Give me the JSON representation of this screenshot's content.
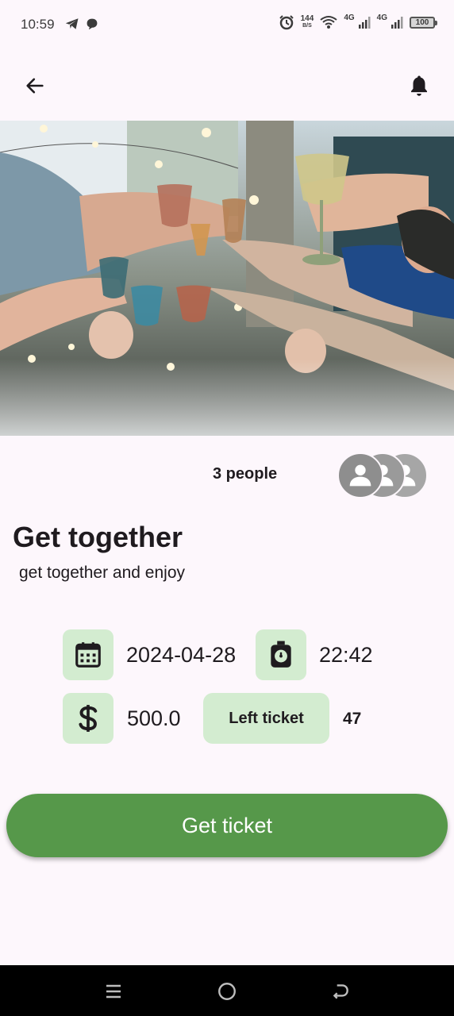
{
  "status_bar": {
    "time": "10:59",
    "net_speed_value": "144",
    "net_speed_unit": "B/S",
    "network_1": "4G",
    "network_2": "4G",
    "battery": "100"
  },
  "app_bar": {
    "back_icon": "arrow-left-icon",
    "notification_icon": "bell-icon"
  },
  "event": {
    "people_count": "3 people",
    "title": "Get together",
    "description": "get together and enjoy",
    "date": "2024-04-28",
    "time": "22:42",
    "price": "500.0",
    "left_ticket_label": "Left ticket",
    "left_ticket_count": "47"
  },
  "actions": {
    "get_ticket_label": "Get ticket"
  },
  "colors": {
    "accent": "#56984a",
    "tile_bg": "#d3ecd0",
    "background": "#fdf7fc"
  }
}
